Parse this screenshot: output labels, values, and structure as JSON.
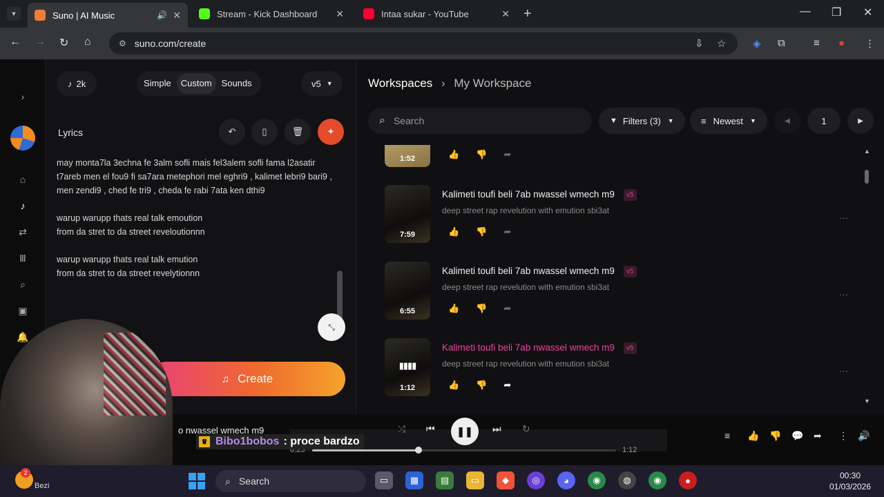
{
  "browser": {
    "tabs": [
      {
        "title": "Suno | AI Music",
        "active": true,
        "audio": true,
        "color": "#f07c3a"
      },
      {
        "title": "Stream - Kick Dashboard",
        "active": false,
        "color": "#53fc18"
      },
      {
        "title": "Intaa sukar - YouTube",
        "active": false,
        "color": "#ff0033"
      }
    ],
    "url": "suno.com/create"
  },
  "left_panel": {
    "credits": "2k",
    "modes": [
      "Simple",
      "Custom",
      "Sounds"
    ],
    "active_mode": "Custom",
    "model": "v5",
    "lyrics_label": "Lyrics",
    "lyrics_text": "may monta7la 3echna fe 3alm sofli mais fel3alem sofli fama l2asatir t7areb men el fou9 fi sa7ara metephori mel eghri9 , kalimet lebri9 bari9 , men zendi9 , ched fe tri9 , cheda fe rabi 7ata ken dthi9\n\nwarup warupp thats real talk emoution\nfrom da stret to da street reveloutionnn\n\nwarup warupp thats real talk emution\nfrom da stret to da street revelytionnn",
    "create_label": "Create"
  },
  "workspace": {
    "breadcrumb_root": "Workspaces",
    "breadcrumb_current": "My Workspace",
    "search_placeholder": "Search",
    "filters_label": "Filters (3)",
    "sort_label": "Newest",
    "page": "1"
  },
  "songs": [
    {
      "duration": "1:52",
      "partial": true
    },
    {
      "title": "Kalimeti toufi beli 7ab nwassel wmech m9",
      "badge": "v5",
      "style": "deep street rap revelution with emution sbi3at",
      "duration": "7:59",
      "playing": false
    },
    {
      "title": "Kalimeti toufi beli 7ab nwassel wmech m9",
      "badge": "v5",
      "style": "deep street rap revelution with emution sbi3at",
      "duration": "6:55",
      "playing": false
    },
    {
      "title": "Kalimeti toufi beli 7ab nwassel wmech m9",
      "badge": "v5",
      "style": "deep street rap revelution with emution sbi3at",
      "duration": "1:12",
      "playing": true
    }
  ],
  "player": {
    "title_fragment": "o nwassel wmech m9",
    "elapsed": "0:25",
    "total": "1:12",
    "progress": 0.35
  },
  "chat_overlay": {
    "user": "Bibo1bobos",
    "message": ": proce bardzo"
  },
  "taskbar": {
    "search": "Search",
    "time": "00:30",
    "date": "01/03/2026",
    "weather_label": "Bezi",
    "weather_badge": "2"
  },
  "colors": {
    "accent_pink": "#e8459a",
    "create_gradient": [
      "#e8407a",
      "#ef6a2e",
      "#f4a32b"
    ],
    "magic_button": "#e54a2a"
  }
}
